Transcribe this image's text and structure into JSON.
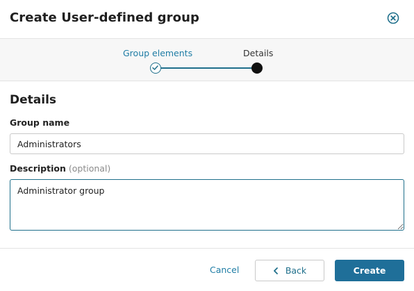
{
  "dialog": {
    "title": "Create User-defined group",
    "close_icon": "close-circle-icon"
  },
  "stepper": {
    "steps": [
      {
        "label": "Group elements",
        "status": "completed"
      },
      {
        "label": "Details",
        "status": "current"
      }
    ]
  },
  "form": {
    "section_title": "Details",
    "group_name": {
      "label": "Group name",
      "value": "Administrators"
    },
    "description": {
      "label": "Description",
      "optional_label": "(optional)",
      "value": "Administrator group"
    }
  },
  "footer": {
    "cancel_label": "Cancel",
    "back_label": "Back",
    "back_icon": "chevron-left-icon",
    "create_label": "Create"
  },
  "colors": {
    "accent": "#1f6f8b",
    "link": "#1f7da5",
    "primary_button": "#1f6f99"
  }
}
